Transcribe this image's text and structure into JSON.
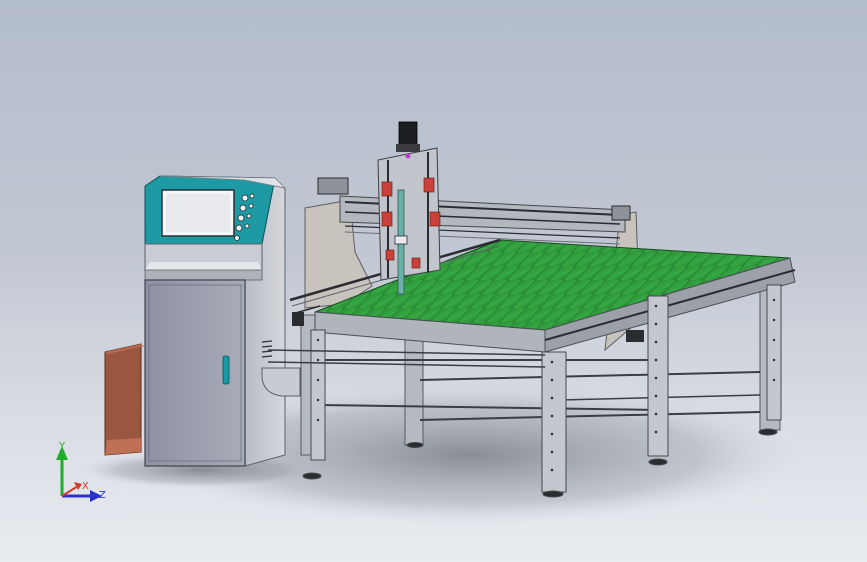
{
  "viewport": {
    "background_top": "#b3bccb",
    "background_bottom": "#e9ecf0"
  },
  "model": {
    "subject": "cnc-gantry-machine-with-control-cabinet",
    "bed_color": "#2f9e3a",
    "cabinet_panel_color": "#1d9aa3",
    "frame_color": "#a2a6ad"
  },
  "triad": {
    "y_label": "Y",
    "x_label": "X",
    "z_label": "Z",
    "y_color": "#1fae2a",
    "x_color": "#d23b2b",
    "z_color": "#2a33c9"
  }
}
